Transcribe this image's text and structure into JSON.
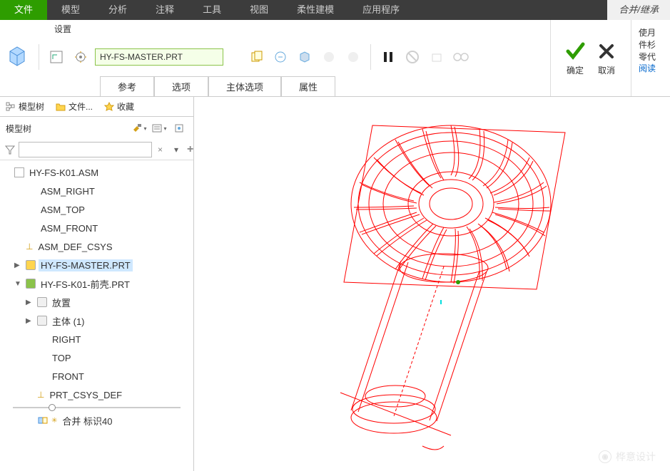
{
  "menubar": [
    {
      "label": "文件",
      "active": true
    },
    {
      "label": "模型"
    },
    {
      "label": "分析"
    },
    {
      "label": "注释"
    },
    {
      "label": "工具"
    },
    {
      "label": "视图"
    },
    {
      "label": "柔性建模"
    },
    {
      "label": "应用程序"
    },
    {
      "label": "合并/继承",
      "last": true
    }
  ],
  "ribbon": {
    "settings_label": "设置",
    "filename": "HY-FS-MASTER.PRT",
    "tabs": [
      "参考",
      "选项",
      "主体选项",
      "属性"
    ],
    "confirm": "确定",
    "cancel": "取消",
    "help_lines": [
      "使月",
      "件杉",
      "零代",
      "阅读"
    ]
  },
  "side_tabs": [
    "模型树",
    "文件...",
    "收藏"
  ],
  "side_toolbar_label": "模型树",
  "tree": [
    {
      "label": "HY-FS-K01.ASM",
      "type": "asm",
      "indent": 0
    },
    {
      "label": "ASM_RIGHT",
      "type": "plane",
      "indent": 1
    },
    {
      "label": "ASM_TOP",
      "type": "plane",
      "indent": 1
    },
    {
      "label": "ASM_FRONT",
      "type": "plane",
      "indent": 1
    },
    {
      "label": "ASM_DEF_CSYS",
      "type": "csys",
      "indent": 1
    },
    {
      "label": "HY-FS-MASTER.PRT",
      "type": "part",
      "indent": 1,
      "expander": "▶",
      "selected": true
    },
    {
      "label": "HY-FS-K01-前壳.PRT",
      "type": "part-green",
      "indent": 1,
      "expander": "▼"
    },
    {
      "label": "放置",
      "type": "folder",
      "indent": 2,
      "expander": "▶"
    },
    {
      "label": "主体 (1)",
      "type": "folder",
      "indent": 2,
      "expander": "▶"
    },
    {
      "label": "RIGHT",
      "type": "plane",
      "indent": 2
    },
    {
      "label": "TOP",
      "type": "plane",
      "indent": 2
    },
    {
      "label": "FRONT",
      "type": "plane",
      "indent": 2
    },
    {
      "label": "PRT_CSYS_DEF",
      "type": "csys",
      "indent": 2
    },
    {
      "label": "合并 标识40",
      "type": "merge",
      "indent": 2
    }
  ],
  "watermark": "桦意设计"
}
